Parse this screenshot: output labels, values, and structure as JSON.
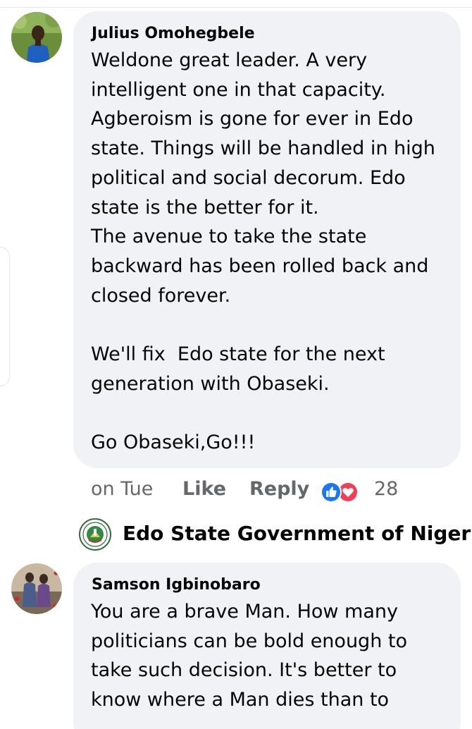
{
  "comments": [
    {
      "author": "Julius Omohegbele",
      "body_lines": [
        "Weldone great leader. A very",
        "intelligent one in that capacity.",
        "Agberoism is gone for ever in Edo",
        "state. Things will be handled in high",
        "political and social decorum. Edo",
        "state is the better for it.",
        "The avenue to take the state",
        "backward has been rolled back and",
        "closed forever.",
        "",
        "We'll fix  Edo state for the next",
        "generation with Obaseki.",
        "",
        "Go Obaseki,Go!!!"
      ],
      "timestamp": "on Tue",
      "like_label": "Like",
      "reply_label": "Reply",
      "reaction_icons": [
        "like-icon",
        "love-icon"
      ],
      "reaction_count": "28"
    },
    {
      "author": "Samson Igbinobaro",
      "body_lines": [
        "You are a brave Man. How many",
        "politicians can be bold enough to",
        "take such decision. It's better to",
        "know where a Man dies than to"
      ]
    }
  ],
  "page_badge": {
    "name": "Edo State Government of Nigeria",
    "logo_icon": "state-seal-icon"
  },
  "colors": {
    "bubble": "#f0f2f5",
    "text": "#050505",
    "secondary_text": "#65676b",
    "like_blue": "#1877f2",
    "love_red": "#f33e58"
  }
}
